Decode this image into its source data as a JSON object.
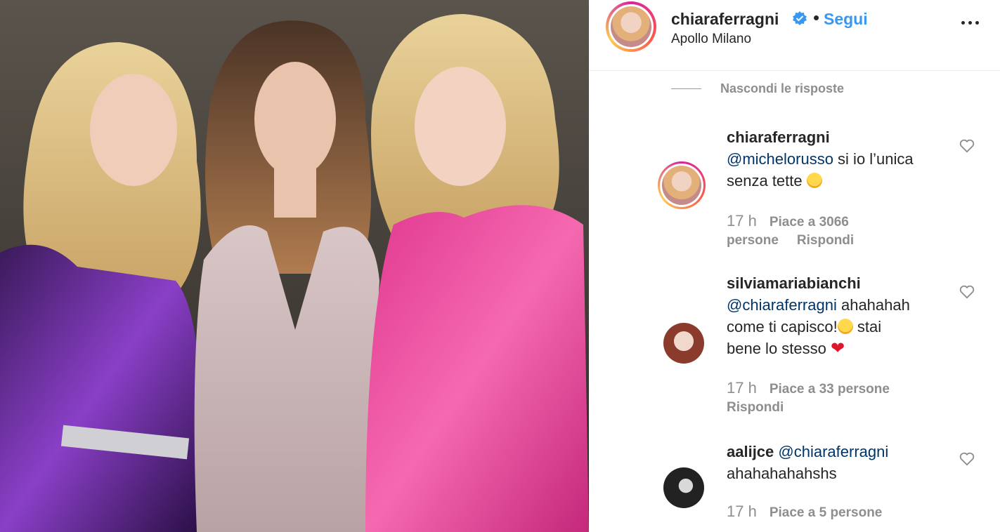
{
  "post": {
    "username": "chiaraferragni",
    "separator": "•",
    "follow_label": "Segui",
    "location": "Apollo Milano",
    "icons": {
      "verified": "verified-badge-icon",
      "more": "more-options-icon"
    }
  },
  "replies": {
    "toggle_label": "Nascondi le risposte"
  },
  "comments": [
    {
      "username": "chiaraferragni",
      "mention": "@michelorusso",
      "text_line1": " si io l’unica",
      "text_line2": "senza tette",
      "emoji": "grinning-sweat-emoji",
      "time": "17 h",
      "likes": "Piace a 3066",
      "likes_cont": "persone",
      "reply": "Rispondi"
    },
    {
      "username": "silviamariabianchi",
      "mention": "@chiaraferragni",
      "text_line1": " ahahahah",
      "text_line2": "come ti capisco!",
      "text_line3a": " stai",
      "text_line3": "bene lo stesso ",
      "emoji": "laughing-tears-emoji",
      "emoji2": "red-heart-emoji",
      "time": "17 h",
      "likes": "Piace a 33 persone",
      "reply": "Rispondi"
    },
    {
      "username": "aalijce",
      "mention": "@chiaraferragni",
      "text_line2": "ahahahahahshs",
      "time": "17 h",
      "likes": "Piace a 5 persone"
    }
  ],
  "colors": {
    "link": "#3897f0",
    "text": "#262626",
    "muted": "#8e8e8e",
    "mention": "#003569"
  }
}
